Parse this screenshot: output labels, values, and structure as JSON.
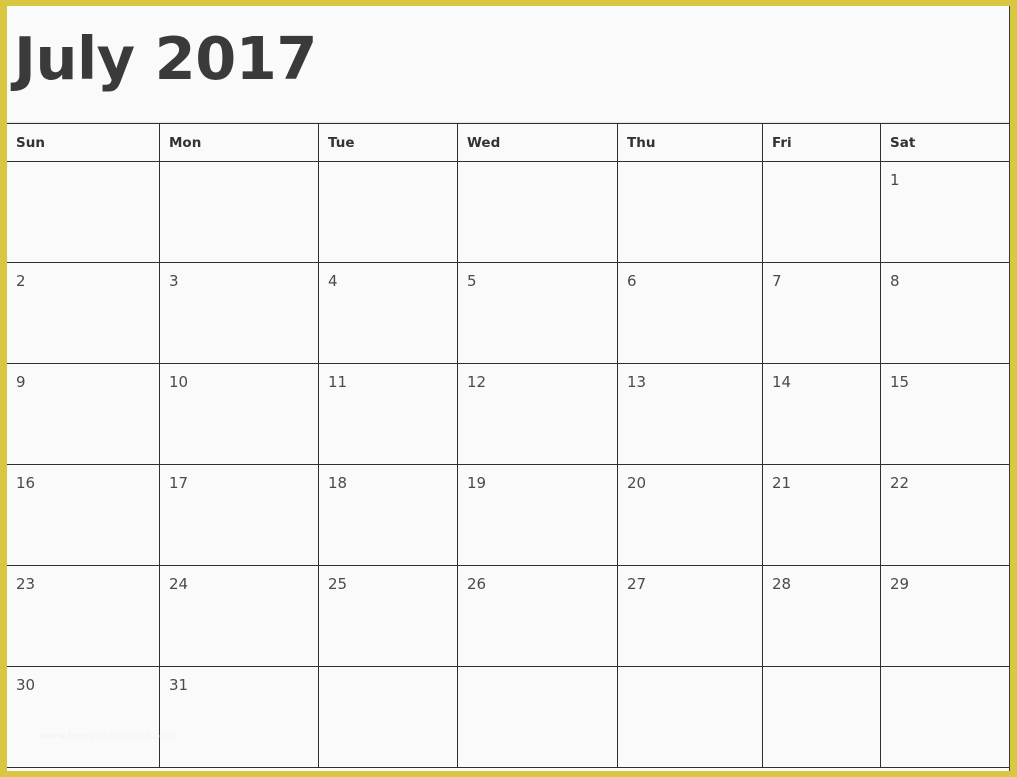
{
  "theme": {
    "frame_color": "#d9c741",
    "page_background": "#fbfafa",
    "title_color": "#3a3a3a",
    "grid_line_color": "#2f2f2f",
    "date_text_color": "#4a4a4a",
    "watermark_color": "#f4f2f2"
  },
  "header": {
    "title": "July 2017"
  },
  "calendar": {
    "weekday_headers": [
      "Sun",
      "Mon",
      "Tue",
      "Wed",
      "Thu",
      "Fri",
      "Sat"
    ],
    "weeks": [
      {
        "days": [
          "",
          "",
          "",
          "",
          "",
          "",
          "1"
        ]
      },
      {
        "days": [
          "2",
          "3",
          "4",
          "5",
          "6",
          "7",
          "8"
        ]
      },
      {
        "days": [
          "9",
          "10",
          "11",
          "12",
          "13",
          "14",
          "15"
        ]
      },
      {
        "days": [
          "16",
          "17",
          "18",
          "19",
          "20",
          "21",
          "22"
        ]
      },
      {
        "days": [
          "23",
          "24",
          "25",
          "26",
          "27",
          "28",
          "29"
        ]
      },
      {
        "days": [
          "30",
          "31",
          "",
          "",
          "",
          "",
          ""
        ]
      }
    ]
  },
  "watermark": {
    "text": "www.freeprintablehd.com"
  }
}
